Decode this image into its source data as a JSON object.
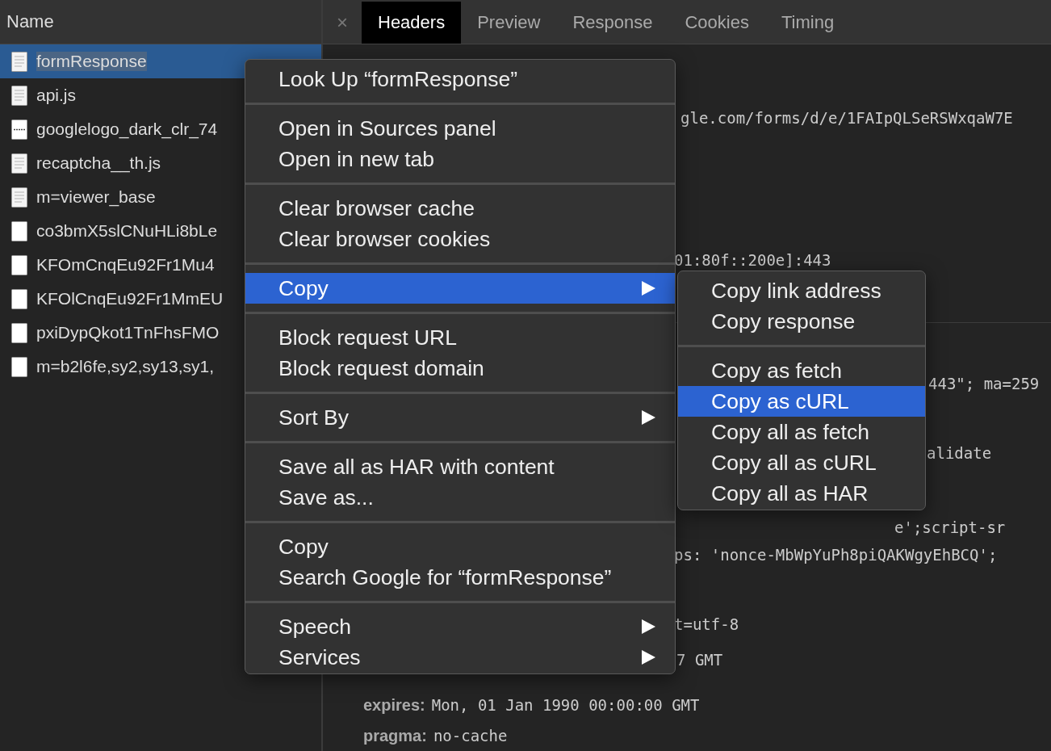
{
  "sidebar": {
    "header": "Name",
    "items": [
      {
        "name": "formResponse",
        "kind": "document",
        "selected": true
      },
      {
        "name": "api.js",
        "kind": "document",
        "selected": false
      },
      {
        "name": "googlelogo_dark_clr_74",
        "kind": "image",
        "selected": false
      },
      {
        "name": "recaptcha__th.js",
        "kind": "document",
        "selected": false
      },
      {
        "name": "m=viewer_base",
        "kind": "document",
        "selected": false
      },
      {
        "name": "co3bmX5slCNuHLi8bLe",
        "kind": "blank",
        "selected": false
      },
      {
        "name": "KFOmCnqEu92Fr1Mu4",
        "kind": "blank",
        "selected": false
      },
      {
        "name": "KFOlCnqEu92Fr1MmEU",
        "kind": "blank",
        "selected": false
      },
      {
        "name": "pxiDypQkot1TnFhsFMO",
        "kind": "blank",
        "selected": false
      },
      {
        "name": "m=b2l6fe,sy2,sy13,sy1,",
        "kind": "blank",
        "selected": false
      }
    ]
  },
  "detail_tabs": {
    "close": "×",
    "tabs": [
      {
        "label": "Headers",
        "selected": true
      },
      {
        "label": "Preview",
        "selected": false
      },
      {
        "label": "Response",
        "selected": false
      },
      {
        "label": "Cookies",
        "selected": false
      },
      {
        "label": "Timing",
        "selected": false
      }
    ]
  },
  "header_lines": [
    {
      "value": "gle.com/forms/d/e/1FAIpQLSeRSWxqaW7E"
    },
    {
      "value": "01:80f::200e]:443"
    },
    {
      "value": "443\"; ma=259"
    },
    {
      "value": "alidate"
    },
    {
      "value": "e';script-sr"
    },
    {
      "value": "ps: 'nonce-MbWpYuPh8piQAKWgyEhBCQ';"
    },
    {
      "value": "t=utf-8"
    },
    {
      "value": "7 GMT"
    },
    {
      "label": "expires:",
      "value": "Mon, 01 Jan 1990 00:00:00 GMT"
    },
    {
      "label": "pragma:",
      "value": "no-cache"
    }
  ],
  "context_menu": {
    "sections": [
      {
        "items": [
          {
            "label": "Look Up “formResponse”",
            "selected": false,
            "submenu": false
          }
        ]
      },
      {
        "items": [
          {
            "label": "Open in Sources panel",
            "selected": false,
            "submenu": false
          },
          {
            "label": "Open in new tab",
            "selected": false,
            "submenu": false
          }
        ]
      },
      {
        "items": [
          {
            "label": "Clear browser cache",
            "selected": false,
            "submenu": false
          },
          {
            "label": "Clear browser cookies",
            "selected": false,
            "submenu": false
          }
        ]
      },
      {
        "items": [
          {
            "label": "Copy",
            "selected": true,
            "submenu": true
          }
        ]
      },
      {
        "items": [
          {
            "label": "Block request URL",
            "selected": false,
            "submenu": false
          },
          {
            "label": "Block request domain",
            "selected": false,
            "submenu": false
          }
        ]
      },
      {
        "items": [
          {
            "label": "Sort By",
            "selected": false,
            "submenu": true
          }
        ]
      },
      {
        "items": [
          {
            "label": "Save all as HAR with content",
            "selected": false,
            "submenu": false
          },
          {
            "label": "Save as...",
            "selected": false,
            "submenu": false
          }
        ]
      },
      {
        "items": [
          {
            "label": "Copy",
            "selected": false,
            "submenu": false
          },
          {
            "label": "Search Google for “formResponse”",
            "selected": false,
            "submenu": false
          }
        ]
      },
      {
        "items": [
          {
            "label": "Speech",
            "selected": false,
            "submenu": true
          },
          {
            "label": "Services",
            "selected": false,
            "submenu": true
          }
        ]
      }
    ]
  },
  "copy_submenu": {
    "sections": [
      {
        "items": [
          {
            "label": "Copy link address",
            "selected": false,
            "submenu": false
          },
          {
            "label": "Copy response",
            "selected": false,
            "submenu": false
          }
        ]
      },
      {
        "items": [
          {
            "label": "Copy as fetch",
            "selected": false,
            "submenu": false
          },
          {
            "label": "Copy as cURL",
            "selected": true,
            "submenu": false
          },
          {
            "label": "Copy all as fetch",
            "selected": false,
            "submenu": false
          },
          {
            "label": "Copy all as cURL",
            "selected": false,
            "submenu": false
          },
          {
            "label": "Copy all as HAR",
            "selected": false,
            "submenu": false
          }
        ]
      }
    ]
  }
}
